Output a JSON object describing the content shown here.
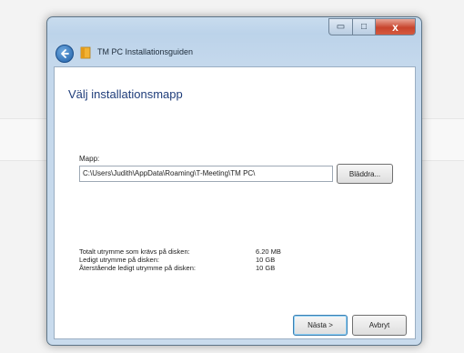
{
  "window": {
    "title": "TM PC Installationsguiden",
    "close_glyph": "x",
    "min_glyph": "▭",
    "max_glyph": "□"
  },
  "page": {
    "heading": "Välj installationsmapp"
  },
  "folder": {
    "label": "Mapp:",
    "path": "C:\\Users\\Judith\\AppData\\Roaming\\T-Meeting\\TM PC\\",
    "browse_label": "Bläddra..."
  },
  "disk_info": {
    "rows": [
      {
        "label": "Totalt utrymme som krävs på disken:",
        "value": "6.20 MB"
      },
      {
        "label": "Ledigt utrymme på disken:",
        "value": "10 GB"
      },
      {
        "label": "Återstående ledigt utrymme på disken:",
        "value": "10 GB"
      }
    ]
  },
  "buttons": {
    "next_label": "Nästa >",
    "cancel_label": "Avbryt"
  },
  "icons": {
    "back": "back-arrow-icon",
    "app": "folder-app-icon"
  },
  "colors": {
    "heading": "#1f3d7a",
    "close_button": "#c8442d",
    "back_button": "#1f5fa8"
  }
}
